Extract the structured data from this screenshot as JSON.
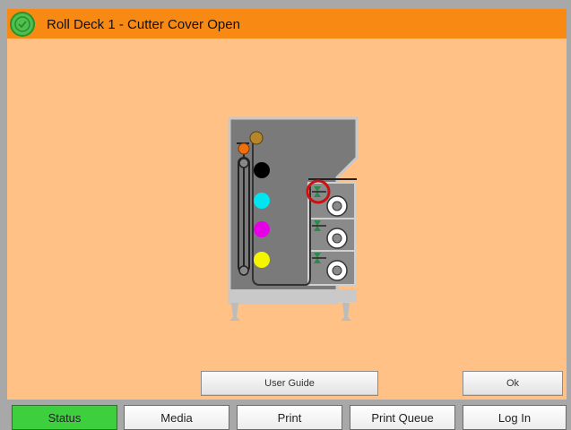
{
  "window": {
    "title": "Roll Deck 1 - Cutter Cover Open",
    "status_icon": "green-ok-icon"
  },
  "illustration": {
    "name": "printer-roll-deck-diagram",
    "ink_colors": [
      "#000000",
      "#00e5f0",
      "#e600e6",
      "#f5f500"
    ],
    "highlight_color": "#cc1010",
    "roll_count": 3
  },
  "buttons": {
    "user_guide": "User Guide",
    "ok": "Ok"
  },
  "tabs": [
    {
      "label": "Status",
      "active": true
    },
    {
      "label": "Media",
      "active": false
    },
    {
      "label": "Print",
      "active": false
    },
    {
      "label": "Print Queue",
      "active": false
    },
    {
      "label": "Log In",
      "active": false
    }
  ],
  "colors": {
    "title_bar": "#f88a14",
    "background": "#ffc186",
    "active_tab": "#3ecf3e"
  }
}
